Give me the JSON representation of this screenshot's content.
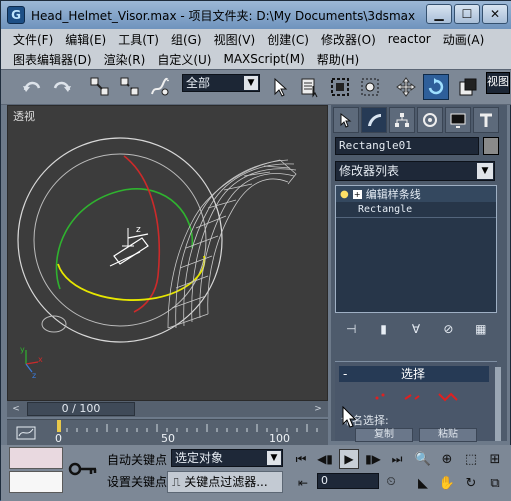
{
  "window": {
    "title": "Head_Helmet_Visor.max     - 项目文件夹: D:\\My Documents\\3dsmax",
    "app_icon_letter": "G",
    "minimize": "▁",
    "maximize": "☐",
    "close": "✕"
  },
  "menu": {
    "row1": [
      "文件(F)",
      "编辑(E)",
      "工具(T)",
      "组(G)",
      "视图(V)",
      "创建(C)",
      "修改器(O)",
      "reactor",
      "动画(A)"
    ],
    "row2": [
      "图表编辑器(D)",
      "渲染(R)",
      "自定义(U)",
      "MAXScript(M)",
      "帮助(H)"
    ]
  },
  "toolbar": {
    "selection_filter": "全部",
    "view_label": "视图"
  },
  "viewport": {
    "label": "透视",
    "axis_x": "x",
    "axis_y": "y",
    "axis_z": "z"
  },
  "command_panel": {
    "object_name": "Rectangle01",
    "modifier_list": "修改器列表",
    "stack": {
      "edit_spline": "编辑样条线",
      "base_object": "Rectangle"
    },
    "selection_rollout": {
      "sign": "-",
      "title": "选择",
      "named_selections": "命名选择:",
      "copy_button": "复制",
      "paste_button": "粘贴"
    }
  },
  "time_slider": {
    "position": "0 / 100",
    "prev": "<",
    "next": ">"
  },
  "trackbar": {
    "ticks": [
      "0",
      "50",
      "100"
    ]
  },
  "status": {
    "auto_key": "自动关键点",
    "set_key": "设置关键点",
    "key_mode": "选定对象",
    "key_filters": "关键点过滤器...",
    "frame": "0"
  },
  "colors": {
    "accent": "#263a55",
    "viewport_bg": "#3c3c3c",
    "helmet_wire": "#c8c8c8",
    "gizmo_red": "#cc2a2a",
    "gizmo_green": "#2fb32f",
    "gizmo_yellow": "#e6e600"
  }
}
